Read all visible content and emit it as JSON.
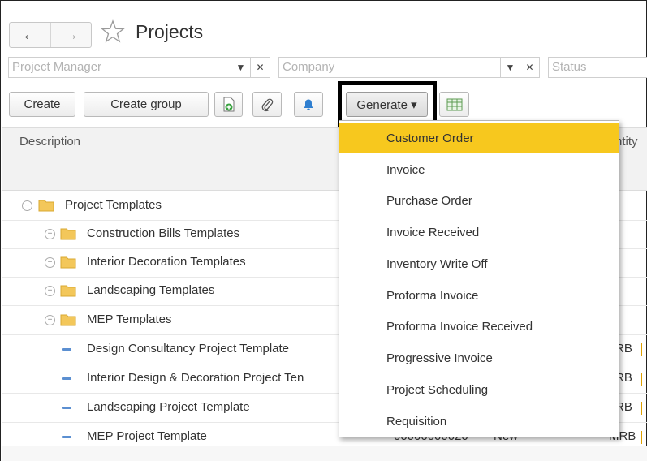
{
  "header": {
    "title": "Projects",
    "back_label": "←",
    "forward_label": "→"
  },
  "filters": [
    {
      "placeholder": "Project Manager"
    },
    {
      "placeholder": "Company"
    },
    {
      "placeholder": "Status"
    }
  ],
  "toolbar": {
    "create_label": "Create",
    "create_group_label": "Create group",
    "generate_label": "Generate ▾",
    "icons": [
      "add-document-icon",
      "paperclip-icon",
      "bell-icon",
      "spreadsheet-icon"
    ]
  },
  "table": {
    "columns": {
      "description": "Description",
      "quantity_partial": "ntity"
    },
    "rows": [
      {
        "type": "group",
        "label": "Project Templates",
        "expanded": true,
        "code": "",
        "status": "",
        "resp": ""
      },
      {
        "type": "group",
        "label": "Construction Bills Templates",
        "expanded": false,
        "code": "",
        "status": "",
        "resp": ""
      },
      {
        "type": "group",
        "label": "Interior Decoration Templates",
        "expanded": false,
        "code": "",
        "status": "",
        "resp": ""
      },
      {
        "type": "group",
        "label": "Landscaping Templates",
        "expanded": false,
        "code": "",
        "status": "",
        "resp": ""
      },
      {
        "type": "group",
        "label": "MEP Templates",
        "expanded": false,
        "code": "",
        "status": "",
        "resp": ""
      },
      {
        "type": "item",
        "label": "Design Consultancy Project Template",
        "code": "",
        "status": "",
        "resp": "RB"
      },
      {
        "type": "item",
        "label": "Interior Design & Decoration Project Ten",
        "code": "",
        "status": "",
        "resp": "RB"
      },
      {
        "type": "item",
        "label": "Landscaping Project Template",
        "code": "",
        "status": "",
        "resp": "RB"
      },
      {
        "type": "item",
        "label": "MEP Project Template",
        "code": "00000000020",
        "status": "New",
        "resp": "MRB"
      }
    ]
  },
  "generate_menu": {
    "selected_index": 0,
    "items": [
      "Customer Order",
      "Invoice",
      "Purchase Order",
      "Invoice Received",
      "Inventory Write Off",
      "Proforma Invoice",
      "Proforma Invoice Received",
      "Progressive Invoice",
      "Project Scheduling",
      "Requisition"
    ]
  },
  "colors": {
    "accent": "#f7c81e",
    "folder": "#f3c75a",
    "item_dash": "#5b8fd1"
  }
}
